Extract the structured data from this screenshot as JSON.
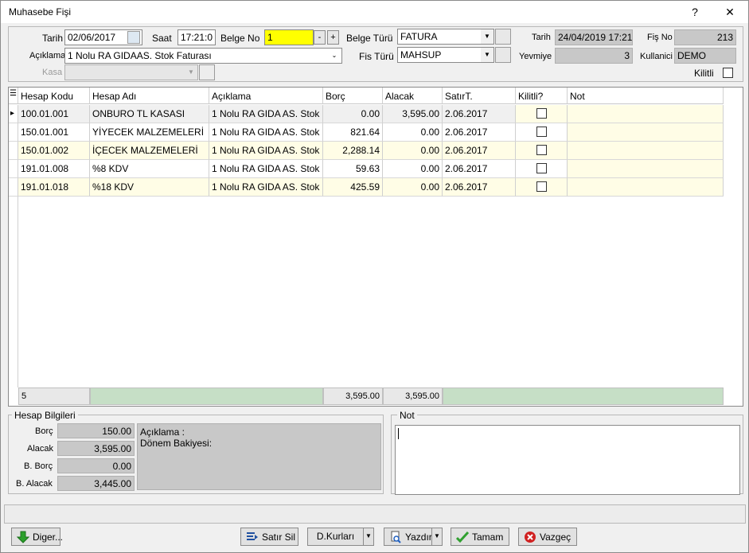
{
  "window": {
    "title": "Muhasebe Fişi",
    "help": "?",
    "close": "✕"
  },
  "header": {
    "tarih_label": "Tarih",
    "tarih_value": "02/06/2017",
    "saat_label": "Saat",
    "saat_value": "17:21:0",
    "belgeno_label": "Belge No",
    "belgeno_value": "1",
    "minus": "-",
    "plus": "+",
    "belgeturu_label": "Belge Türü",
    "belgeturu_value": "FATURA",
    "fisturu_label": "Fis Türü",
    "fisturu_value": "MAHSUP",
    "aciklama_label": "Açıklama",
    "aciklama_value": "1 Nolu RA GIDAAS. Stok Faturası",
    "kasa_label": "Kasa",
    "kasa_value": "",
    "info_tarih_label": "Tarih",
    "info_tarih_value": "24/04/2019 17:21",
    "yevmiye_label": "Yevmiye",
    "yevmiye_value": "3",
    "fisno_label": "Fiş No",
    "fisno_value": "213",
    "kullanici_label": "Kullanici",
    "kullanici_value": "DEMO",
    "kilitli_label": "Kilitli"
  },
  "grid": {
    "columns": [
      "Hesap Kodu",
      "Hesap Adı",
      "Açıklama",
      "Borç",
      "Alacak",
      "SatırT.",
      "Kilitli?",
      "Not"
    ],
    "rows": [
      {
        "kod": "100.01.001",
        "ad": "ONBURO TL KASASI",
        "aciklama": "1 Nolu RA GIDA AS. Stok",
        "borc": "0.00",
        "alacak": "3,595.00",
        "tarih": "2.06.2017",
        "kilitli": false,
        "not": ""
      },
      {
        "kod": "150.01.001",
        "ad": "YİYECEK MALZEMELERİ",
        "aciklama": "1 Nolu RA GIDA AS. Stok",
        "borc": "821.64",
        "alacak": "0.00",
        "tarih": "2.06.2017",
        "kilitli": false,
        "not": ""
      },
      {
        "kod": "150.01.002",
        "ad": "İÇECEK MALZEMELERİ",
        "aciklama": "1 Nolu RA GIDA AS. Stok",
        "borc": "2,288.14",
        "alacak": "0.00",
        "tarih": "2.06.2017",
        "kilitli": false,
        "not": ""
      },
      {
        "kod": "191.01.008",
        "ad": "%8 KDV",
        "aciklama": "1 Nolu RA GIDA AS. Stok",
        "borc": "59.63",
        "alacak": "0.00",
        "tarih": "2.06.2017",
        "kilitli": false,
        "not": ""
      },
      {
        "kod": "191.01.018",
        "ad": "%18 KDV",
        "aciklama": "1 Nolu RA GIDA AS. Stok",
        "borc": "425.59",
        "alacak": "0.00",
        "tarih": "2.06.2017",
        "kilitli": false,
        "not": ""
      }
    ],
    "footer": {
      "count": "5",
      "borc_total": "3,595.00",
      "alacak_total": "3,595.00"
    }
  },
  "hesap": {
    "title": "Hesap Bilgileri",
    "borc_label": "Borç",
    "borc_value": "150.00",
    "alacak_label": "Alacak",
    "alacak_value": "3,595.00",
    "bborc_label": "B. Borç",
    "bborc_value": "0.00",
    "balacak_label": "B. Alacak",
    "balacak_value": "3,445.00",
    "aciklama_text": "Açıklama :",
    "donem_text": "Dönem Bakiyesi:"
  },
  "not": {
    "title": "Not",
    "value": ""
  },
  "buttons": {
    "diger": "Diger...",
    "satirsil": "Satır Sil",
    "dkurlari": "D.Kurları",
    "yazdir": "Yazdır",
    "tamam": "Tamam",
    "vazgec": "Vazgeç"
  },
  "colors": {
    "highlight": "#ffff00",
    "alt_row": "#fffde6",
    "footer_green": "#c6dfc6"
  }
}
